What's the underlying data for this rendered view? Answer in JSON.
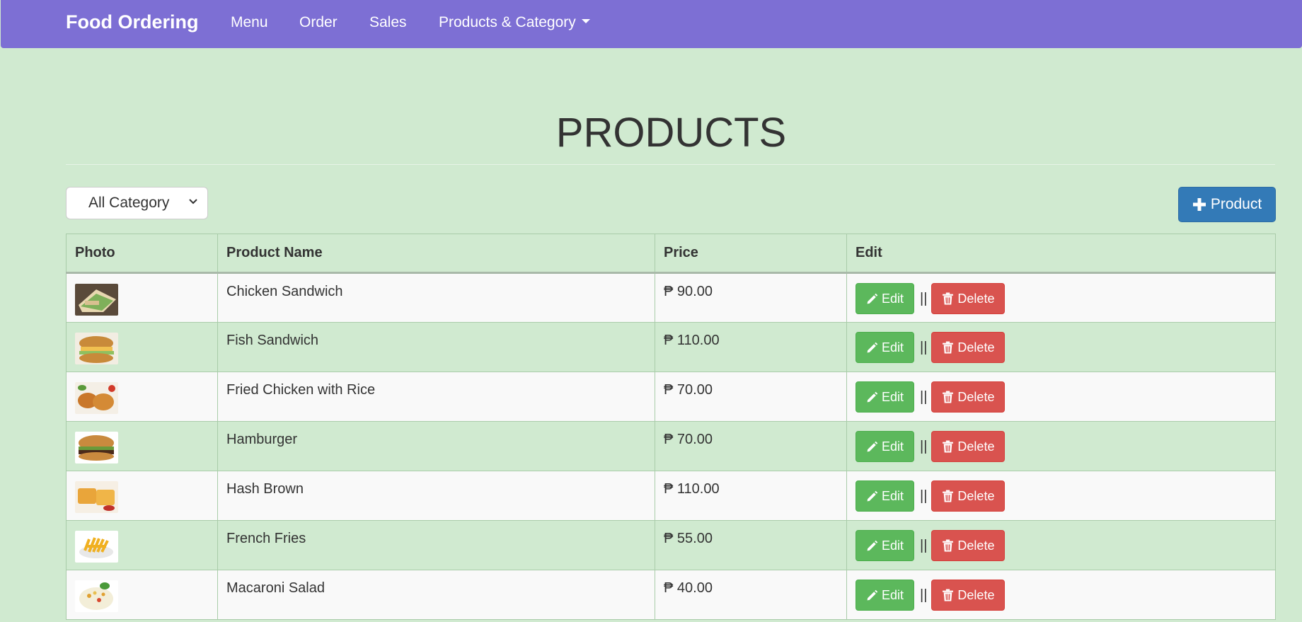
{
  "nav": {
    "brand": "Food Ordering",
    "links": [
      "Menu",
      "Order",
      "Sales",
      "Products & Category"
    ]
  },
  "page": {
    "title": "PRODUCTS",
    "category_select": "All Category",
    "add_button": "Product"
  },
  "table": {
    "headers": [
      "Photo",
      "Product Name",
      "Price",
      "Edit"
    ],
    "edit_label": "Edit",
    "delete_label": "Delete",
    "separator": "||",
    "rows": [
      {
        "name": "Chicken Sandwich",
        "price": "₱ 90.00"
      },
      {
        "name": "Fish Sandwich",
        "price": "₱ 110.00"
      },
      {
        "name": "Fried Chicken with Rice",
        "price": "₱ 70.00"
      },
      {
        "name": "Hamburger",
        "price": "₱ 70.00"
      },
      {
        "name": "Hash Brown",
        "price": "₱ 110.00"
      },
      {
        "name": "French Fries",
        "price": "₱ 55.00"
      },
      {
        "name": "Macaroni Salad",
        "price": "₱ 40.00"
      }
    ]
  },
  "colors": {
    "navbar": "#7d6fd4",
    "background": "#d0ead0",
    "primary": "#337ab7",
    "success": "#5cb85c",
    "danger": "#d9534f"
  }
}
